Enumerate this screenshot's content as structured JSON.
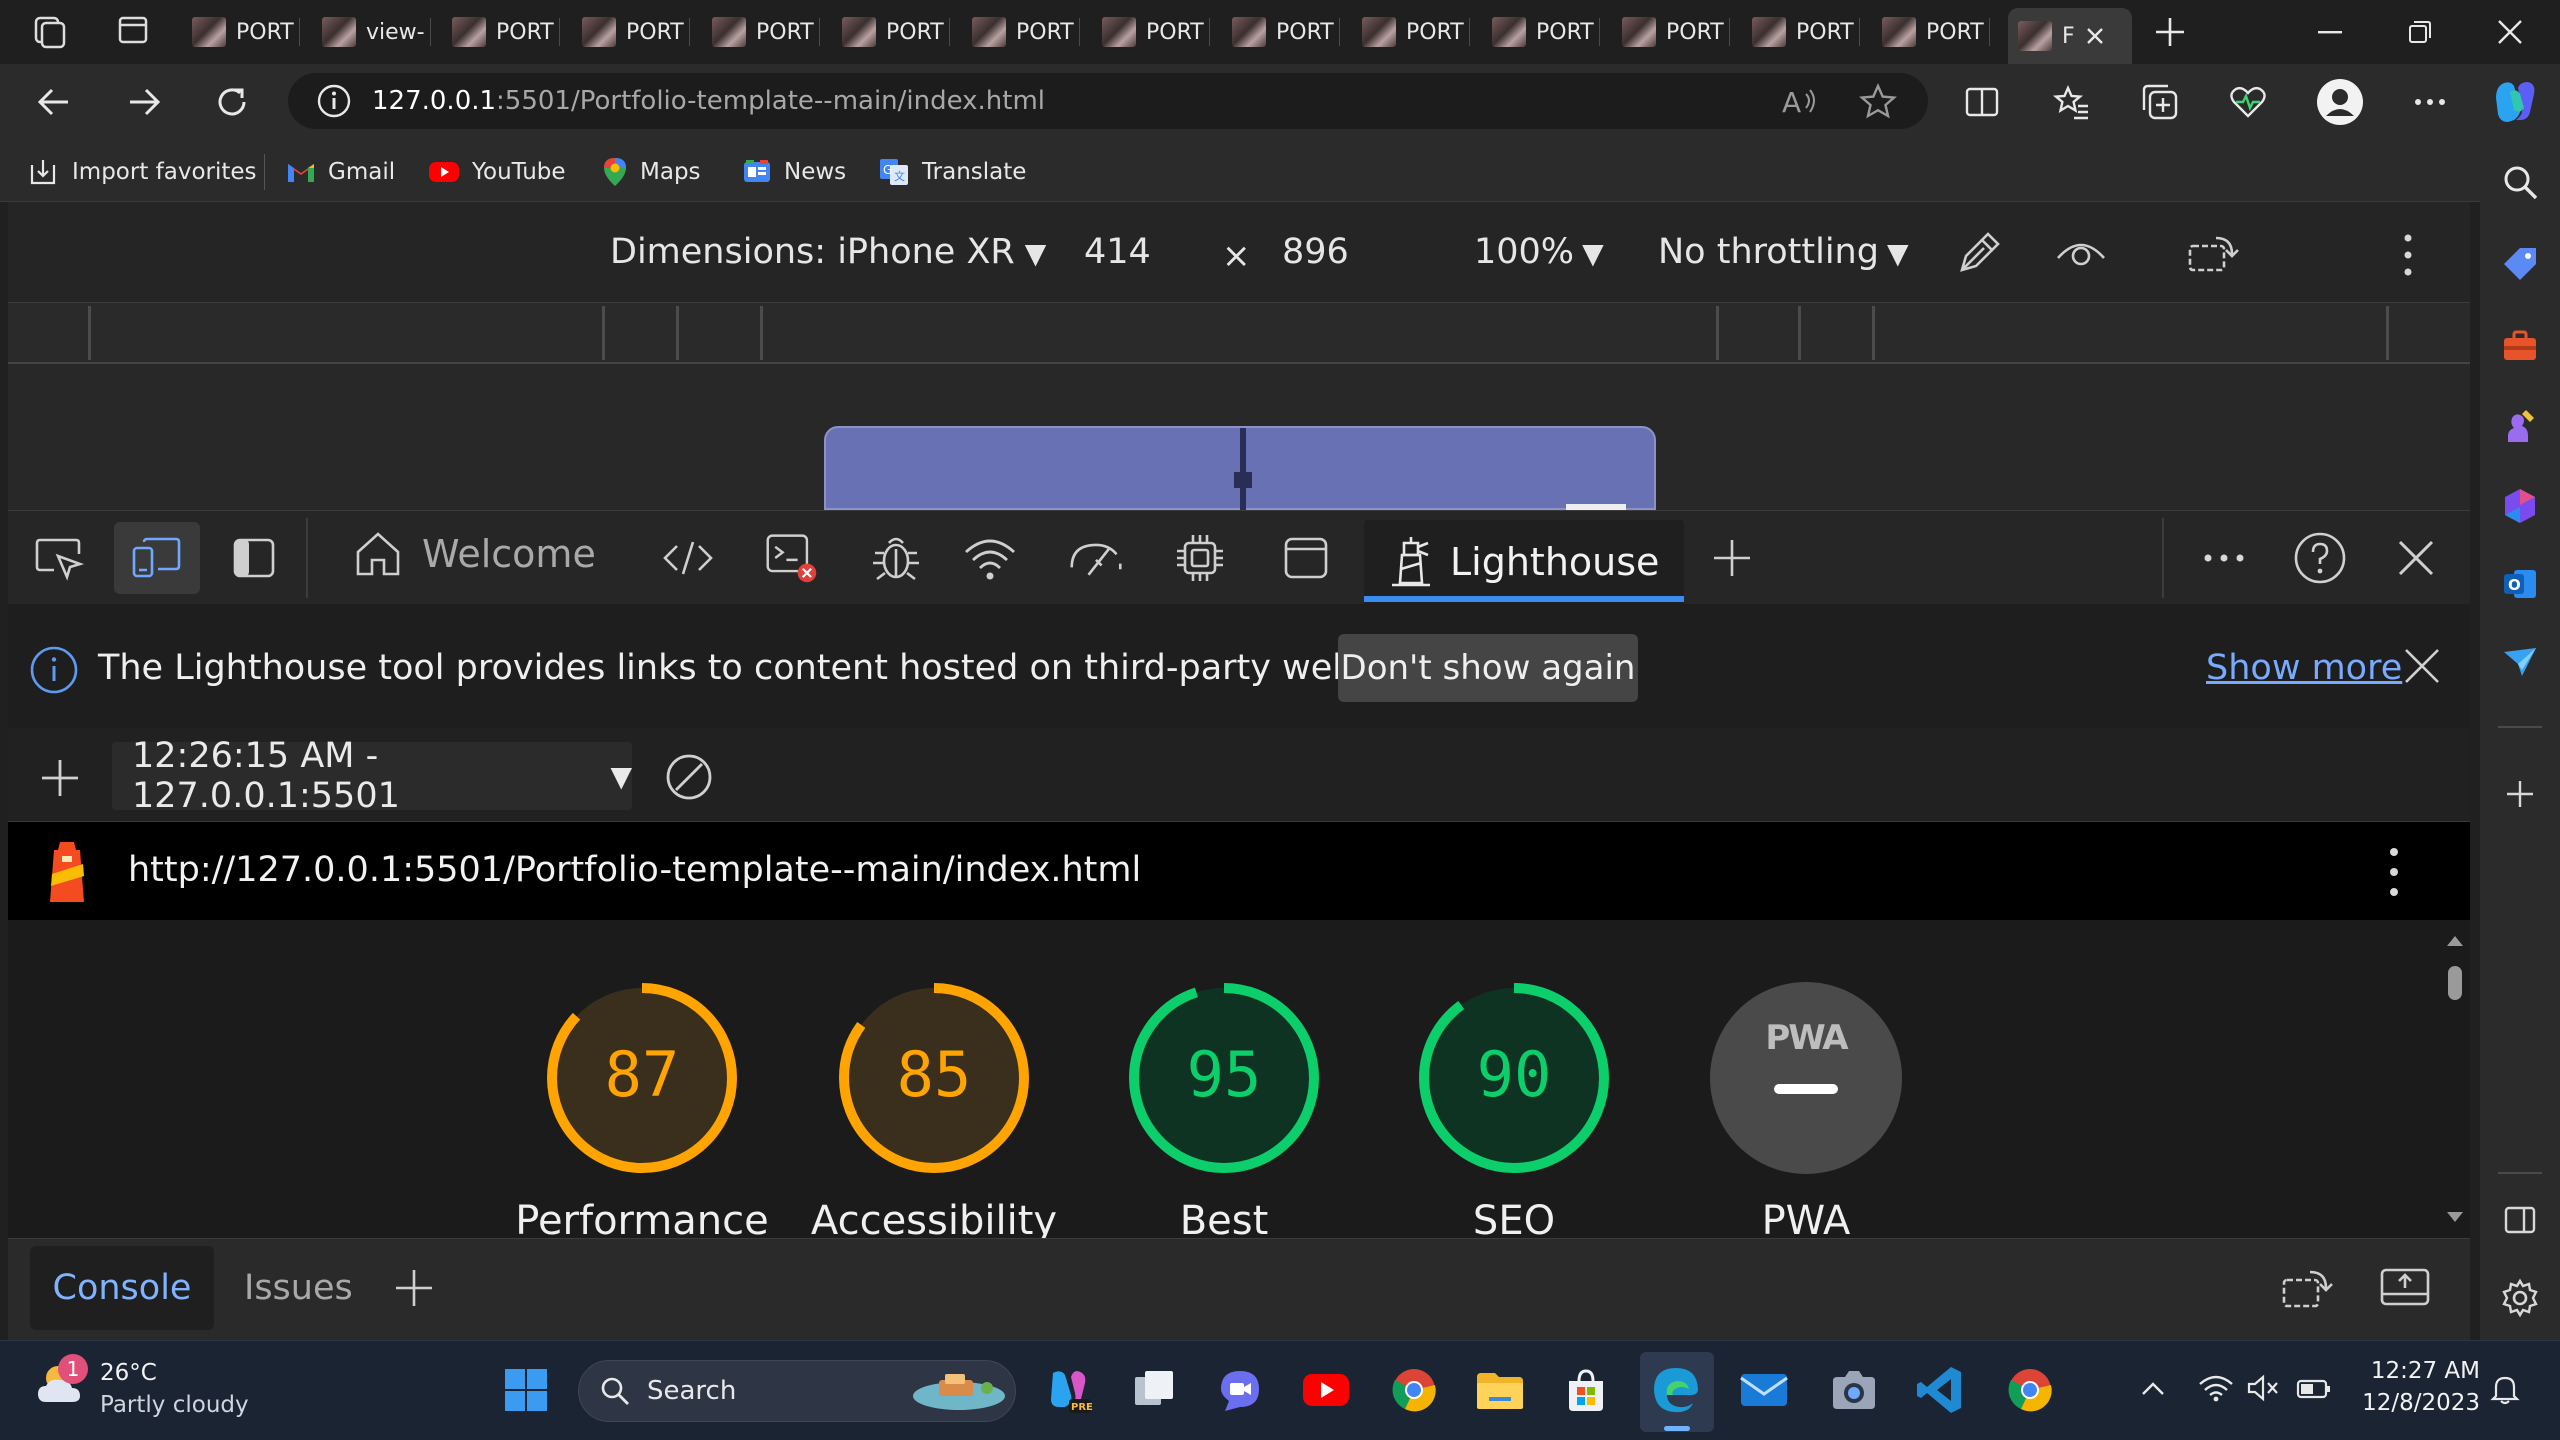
{
  "tabs": [
    {
      "label": "PORT"
    },
    {
      "label": "view-"
    },
    {
      "label": "PORT"
    },
    {
      "label": "PORT"
    },
    {
      "label": "PORT"
    },
    {
      "label": "PORT"
    },
    {
      "label": "PORT"
    },
    {
      "label": "PORT"
    },
    {
      "label": "PORT"
    },
    {
      "label": "PORT"
    },
    {
      "label": "PORT"
    },
    {
      "label": "PORT"
    },
    {
      "label": "PORT"
    },
    {
      "label": "PORT"
    },
    {
      "label": "F"
    }
  ],
  "address": {
    "host": "127.0.0.1",
    "path": ":5501/Portfolio-template--main/index.html"
  },
  "favorites": [
    {
      "label": "Import favorites"
    },
    {
      "label": "Gmail"
    },
    {
      "label": "YouTube"
    },
    {
      "label": "Maps"
    },
    {
      "label": "News"
    },
    {
      "label": "Translate"
    }
  ],
  "device_toolbar": {
    "dimensions": "Dimensions: iPhone XR",
    "width": "414",
    "times": "×",
    "height": "896",
    "zoom": "100%",
    "throttling": "No throttling"
  },
  "devtools": {
    "welcome_label": "Welcome",
    "lighthouse_label": "Lighthouse",
    "info_message": "The Lighthouse tool provides links to content hosted on third-party websites.",
    "dont_show_again": "Don't show again",
    "show_more": "Show more",
    "report_select": "12:26:15 AM - 127.0.0.1:5501",
    "report_url": "http://127.0.0.1:5501/Portfolio-template--main/index.html",
    "pwa_badge": "PWA",
    "scores": [
      {
        "label": "Performance",
        "value": "87",
        "score": 87,
        "color": "#ffa400"
      },
      {
        "label": "Accessibility",
        "value": "85",
        "score": 85,
        "color": "#ffa400"
      },
      {
        "label": "Best",
        "value": "95",
        "score": 95,
        "color": "#0cce6b"
      },
      {
        "label": "SEO",
        "value": "90",
        "score": 90,
        "color": "#0cce6b"
      },
      {
        "label": "PWA",
        "value": "",
        "score": null,
        "color": "#777777"
      }
    ],
    "drawer_tabs": [
      {
        "label": "Console"
      },
      {
        "label": "Issues"
      }
    ]
  },
  "taskbar": {
    "weather_temp": "26°C",
    "weather_desc": "Partly cloudy",
    "weather_badge": "1",
    "search_placeholder": "Search",
    "time": "12:27 AM",
    "date": "12/8/2023"
  }
}
